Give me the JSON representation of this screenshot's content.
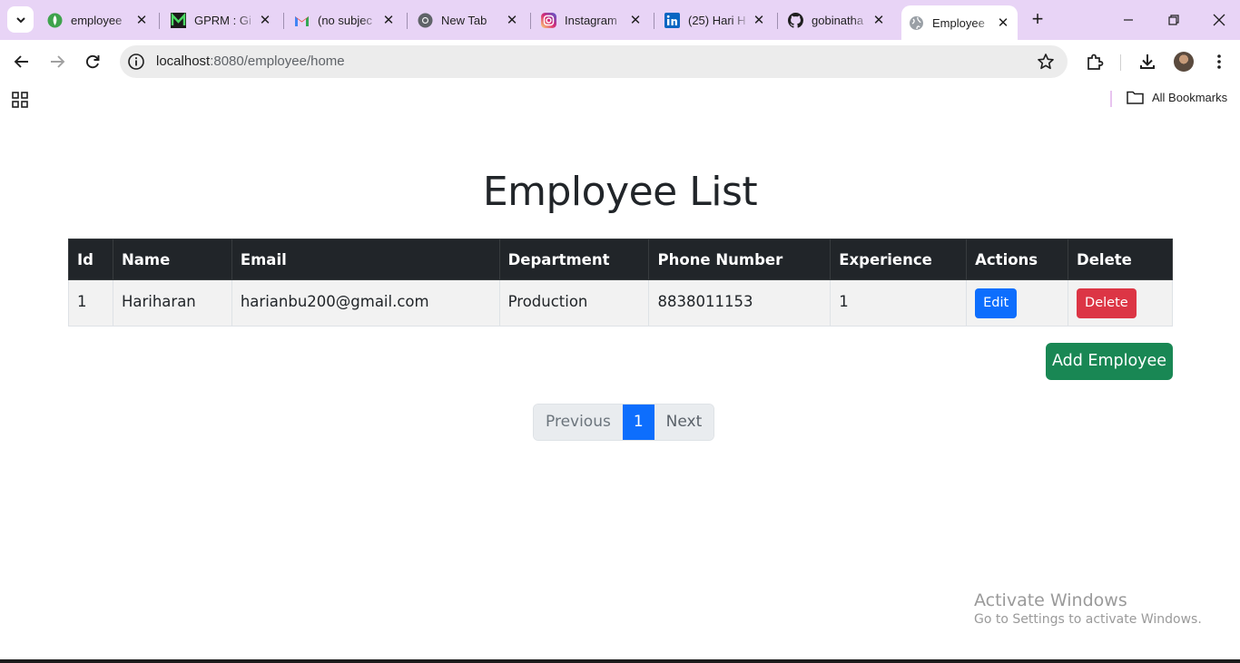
{
  "browser": {
    "tabs": [
      {
        "title": "employee",
        "icon": "green-leaf-icon",
        "active": false
      },
      {
        "title": "GPRM : Gi",
        "icon": "gprm-logo-icon",
        "active": false
      },
      {
        "title": "(no subjec",
        "icon": "gmail-icon",
        "active": false
      },
      {
        "title": "New Tab",
        "icon": "chrome-icon",
        "active": false
      },
      {
        "title": "Instagram",
        "icon": "instagram-icon",
        "active": false
      },
      {
        "title": "(25) Hari H",
        "icon": "linkedin-icon",
        "active": false
      },
      {
        "title": "gobinatha",
        "icon": "github-icon",
        "active": false
      },
      {
        "title": "Employee",
        "icon": "globe-icon",
        "active": true
      }
    ],
    "url_host": "localhost",
    "url_rest": ":8080/employee/home",
    "bookmarks_label": "All Bookmarks"
  },
  "page": {
    "title": "Employee List",
    "table": {
      "headers": [
        "Id",
        "Name",
        "Email",
        "Department",
        "Phone Number",
        "Experience",
        "Actions",
        "Delete"
      ],
      "rows": [
        {
          "id": "1",
          "name": "Hariharan",
          "email": "harianbu200@gmail.com",
          "department": "Production",
          "phone": "8838011153",
          "experience": "1",
          "edit_label": "Edit",
          "delete_label": "Delete"
        }
      ]
    },
    "add_button": "Add Employee",
    "pagination": {
      "previous": "Previous",
      "current": "1",
      "next": "Next"
    }
  },
  "watermark": {
    "line1": "Activate Windows",
    "line2": "Go to Settings to activate Windows."
  },
  "colors": {
    "header_bg": "#212529",
    "edit": "#0d6efd",
    "delete": "#dc3545",
    "add": "#198754",
    "tabstrip": "#e8d4f6"
  }
}
